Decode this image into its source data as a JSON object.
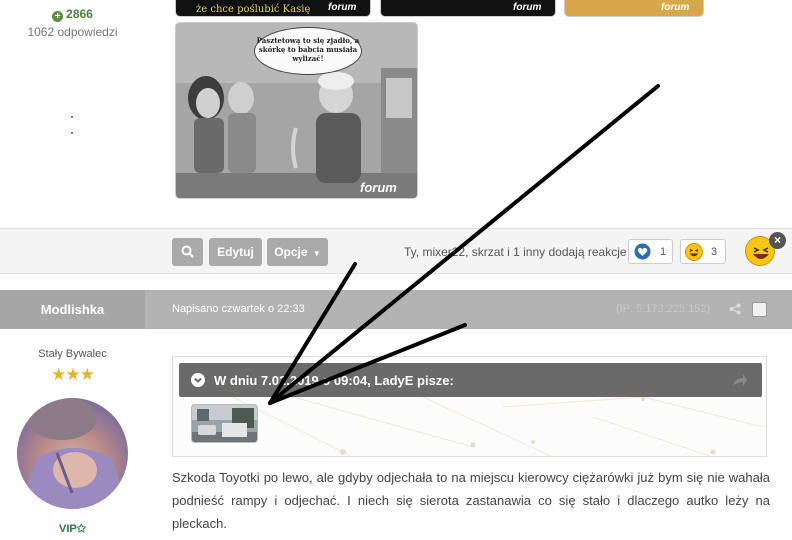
{
  "prev_post": {
    "reputation": "2866",
    "answers": "1062 odpowiedzi",
    "thumbs": [
      {
        "caption": "że chce poślubić Kasię",
        "watermark": "forum"
      },
      {
        "caption": "",
        "watermark": "forum"
      },
      {
        "caption": "",
        "watermark": "forum"
      }
    ],
    "meme": {
      "bubble_text": "Pasztetową to się zjadło, a skórkę to babcia musiała wylizać!",
      "watermark": "forum"
    },
    "buttons": {
      "edit": "Edytuj",
      "options": "Opcje"
    },
    "reactions_text": "Ty, mixer22, skrzat i 1 inny dodają reakcje",
    "reactions": [
      {
        "icon": "heart-icon",
        "count": "1"
      },
      {
        "icon": "laugh-emoji-icon",
        "count": "3"
      }
    ]
  },
  "post": {
    "author": "Modlishka",
    "date": "Napisano czwartek o 22:33",
    "ip": "(IP: 5.173.225.152)",
    "rank": "Stały Bywalec",
    "stars": "★★★",
    "group": "VIP✩",
    "quote_header": "W dniu 7.02.2019 o 09:04, LadyE pisze:",
    "body": "Szkoda Toyotki po lewo, ale gdyby odjechała to na miejscu kierowcy ciężarówki już bym się nie wahała podnieść rampy i odjechać. I niech się sierota zastanawia co się stało i dlaczego autko leży na pleckach."
  },
  "colors": {
    "post_header_bg": "#b3b3b3",
    "quote_header_bg": "#6a6a6a",
    "button_bg": "#aaaaaa",
    "reputation_green": "#4a7f3a",
    "star_gold": "#e2b52e"
  }
}
